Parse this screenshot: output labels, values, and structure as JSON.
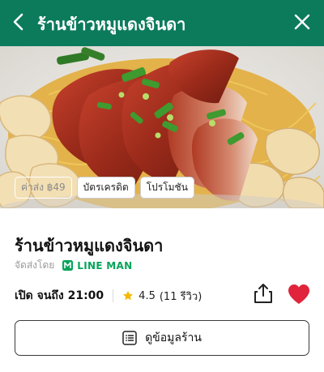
{
  "header": {
    "title": "ร้านข้าวหมูแดงจินดา",
    "background": "#0b7b5c",
    "back_icon": "chevron-left-icon",
    "close_icon": "close-icon"
  },
  "hero": {
    "tags": [
      "ค่าส่ง ฿49",
      "บัตรเครดิต",
      "โปรโมชัน"
    ]
  },
  "restaurant": {
    "name": "ร้านข้าวหมูแดงจินดา",
    "delivery_label": "จัดส่งโดย",
    "delivery_partner": "LINE MAN",
    "partner_color": "#06a55a",
    "open_hours": "เปิด จนถึง 21:00",
    "rating": "4.5",
    "review_count": "(11 รีวิว)",
    "star_color": "#f5b800",
    "favorite_color": "#e0243c"
  },
  "actions": {
    "details_button": "ดูข้อมูลร้าน",
    "share_icon": "share-icon",
    "favorite_icon": "heart-icon",
    "details_icon": "list-icon"
  }
}
